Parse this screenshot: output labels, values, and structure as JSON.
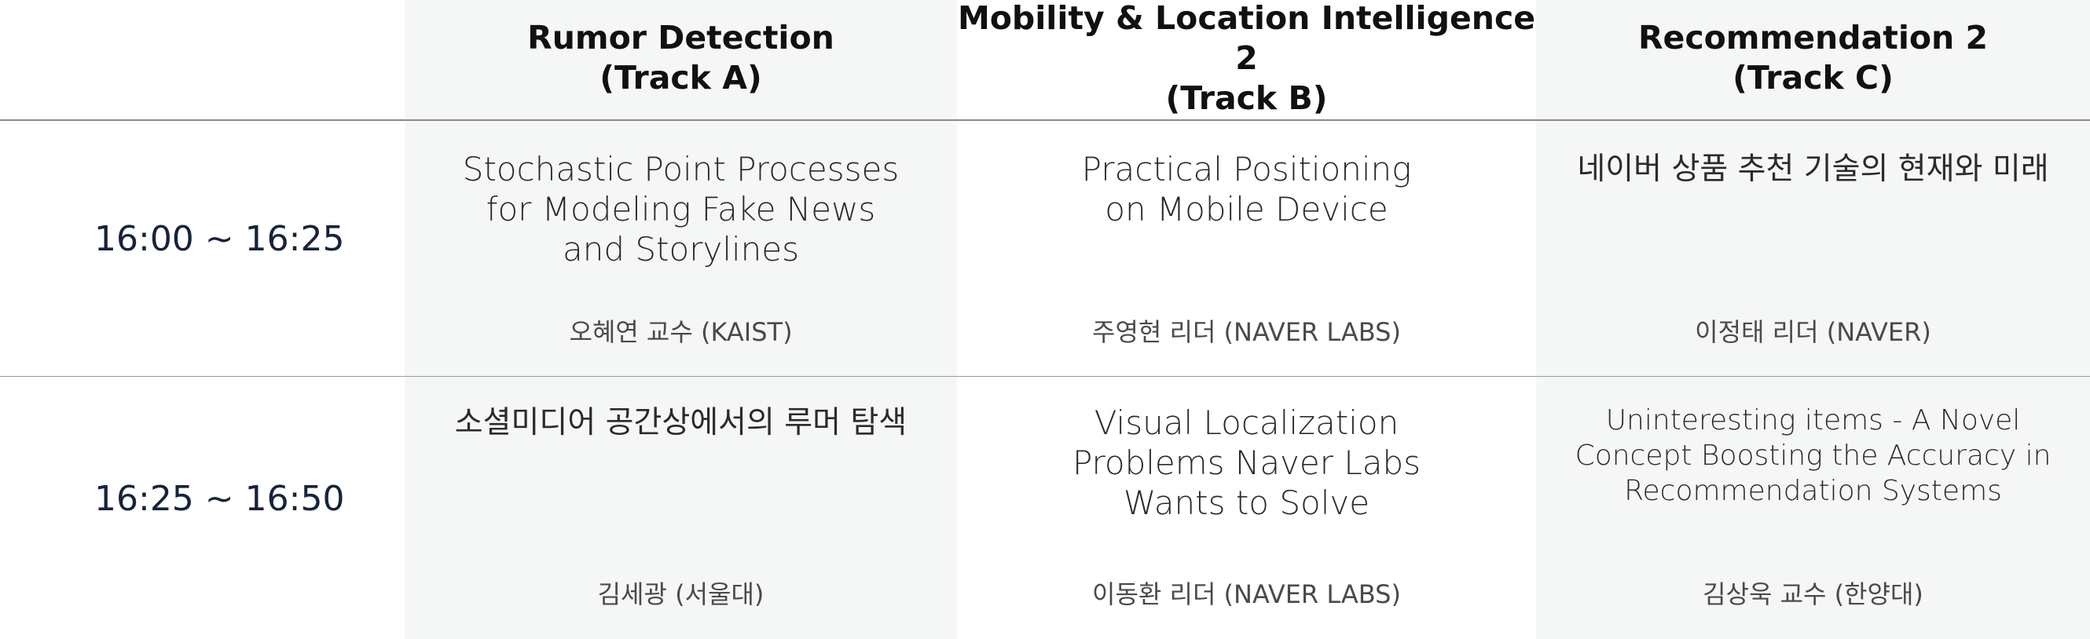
{
  "tracks": [
    {
      "name": "Rumor Detection",
      "track": "(Track A)"
    },
    {
      "name": "Mobility & Location Intelligence 2",
      "track": "(Track B)"
    },
    {
      "name": "Recommendation 2",
      "track": "(Track C)"
    }
  ],
  "sessions": [
    {
      "time": "16:00 ~ 16:25",
      "talks": [
        {
          "title": "Stochastic Point Processes for Modeling Fake News and Storylines",
          "speaker": "오혜연 교수 (KAIST)"
        },
        {
          "title": "Practical Positioning on Mobile Device",
          "speaker": "주영현 리더 (NAVER LABS)"
        },
        {
          "title": "네이버 상품 추천 기술의 현재와 미래",
          "speaker": "이정태 리더 (NAVER)"
        }
      ]
    },
    {
      "time": "16:25 ~ 16:50",
      "talks": [
        {
          "title": "소셜미디어 공간상에서의 루머 탐색",
          "speaker": "김세광 (서울대)"
        },
        {
          "title": "Visual Localization Problems Naver Labs Wants to Solve",
          "speaker": "이동환 리더 (NAVER LABS)"
        },
        {
          "title": "Uninteresting items - A Novel Concept Boosting the Accuracy in Recommendation Systems",
          "speaker": "김상욱 교수 (한양대)"
        }
      ]
    }
  ]
}
